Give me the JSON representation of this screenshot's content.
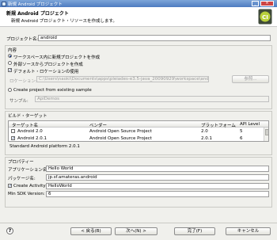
{
  "window": {
    "title": "新規 Android プロジェクト"
  },
  "header": {
    "title": "新規 Android プロジェクト",
    "subtitle": "新規 Android プロジェクト・リソースを作成します。"
  },
  "project_name": {
    "label": "プロジェクト名:",
    "value": "android"
  },
  "contents": {
    "group_label": "内容",
    "radio_new": "ワークスペース内に新規プロジェクトを作成",
    "radio_external": "外部ソースからプロジェクトを作成",
    "checkbox_default_location": "デフォルト・ロケーションの使用",
    "location_label": "ロケーション:",
    "location_value": "C:\\Users\\naoki\\Documents\\apps\\pleiades-e3.5-java_20090929\\workspace\\android",
    "browse_button": "参照...",
    "radio_sample": "Create project from existing sample",
    "sample_label": "サンプル:",
    "sample_value": "ApiDemos"
  },
  "build_target": {
    "group_label": "ビルド・ターゲット",
    "columns": [
      "ターゲット名",
      "ベンダー",
      "プラットフォーム",
      "API Level"
    ],
    "rows": [
      {
        "name": "Android 2.0",
        "vendor": "Android Open Source Project",
        "platform": "2.0",
        "api": "5",
        "checked": false
      },
      {
        "name": "Android 2.0.1",
        "vendor": "Android Open Source Project",
        "platform": "2.0.1",
        "api": "6",
        "checked": true
      }
    ],
    "status": "Standard Android platform 2.0.1"
  },
  "properties": {
    "group_label": "プロパティー",
    "app_name_label": "アプリケーション名:",
    "app_name_value": "Hello World",
    "package_label": "パッケージ名:",
    "package_value": "jp.sf.amateras.android",
    "activity_label": "Create Activity:",
    "activity_value": "HelloWorld",
    "min_sdk_label": "Min SDK Version:",
    "min_sdk_value": "6"
  },
  "footer": {
    "back": "< 戻る(B)",
    "next": "次へ(N) >",
    "finish": "完了(F)",
    "cancel": "キャンセル"
  },
  "colors": {
    "title_bar": "#4d7bc0",
    "dialog_bg": "#f0f0ec",
    "selected_radio": "#1a3a80"
  }
}
